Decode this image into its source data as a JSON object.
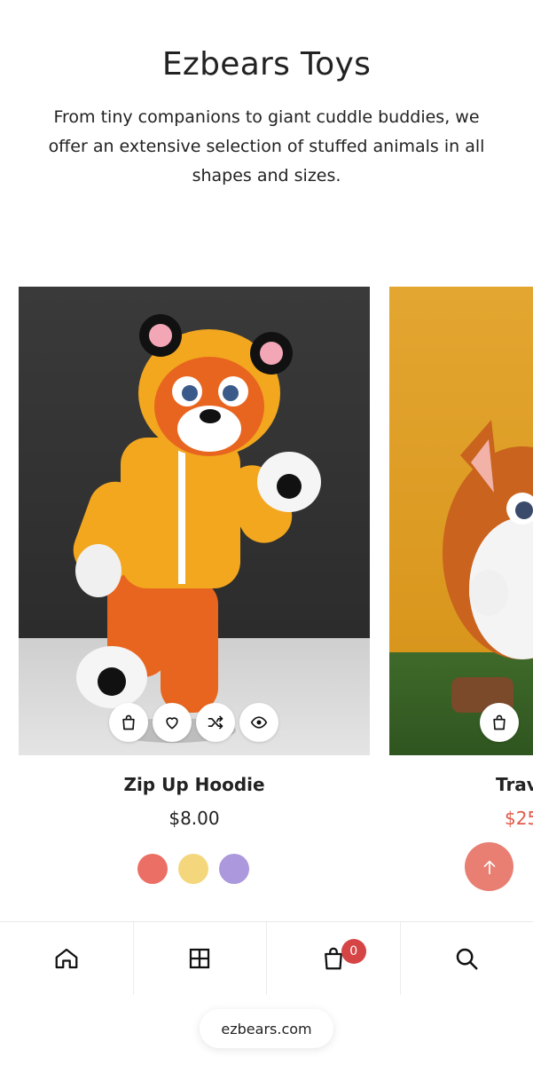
{
  "header": {
    "title": "Ezbears Toys",
    "subtitle": "From tiny companions to giant cuddle buddies, we offer an extensive selection of stuffed animals in all shapes and sizes."
  },
  "products": [
    {
      "name": "Zip Up Hoodie",
      "price": "$8.00",
      "image_icon": "tiger-plush-image",
      "swatches": [
        "#ec6f66",
        "#f4d77c",
        "#ab98dd"
      ],
      "actions": [
        "bag-icon",
        "heart-icon",
        "shuffle-icon",
        "eye-icon"
      ]
    },
    {
      "name": "Trav",
      "price": "$25",
      "image_icon": "fox-plush-image",
      "actions": [
        "bag-icon"
      ]
    }
  ],
  "bottom_nav": {
    "items": [
      "home-icon",
      "grid-icon",
      "cart-icon",
      "search-icon"
    ],
    "cart_count": "0"
  },
  "browser": {
    "url": "ezbears.com"
  },
  "colors": {
    "accent": "#e87f72",
    "badge": "#d64545",
    "sale_price": "#e05a4a"
  }
}
